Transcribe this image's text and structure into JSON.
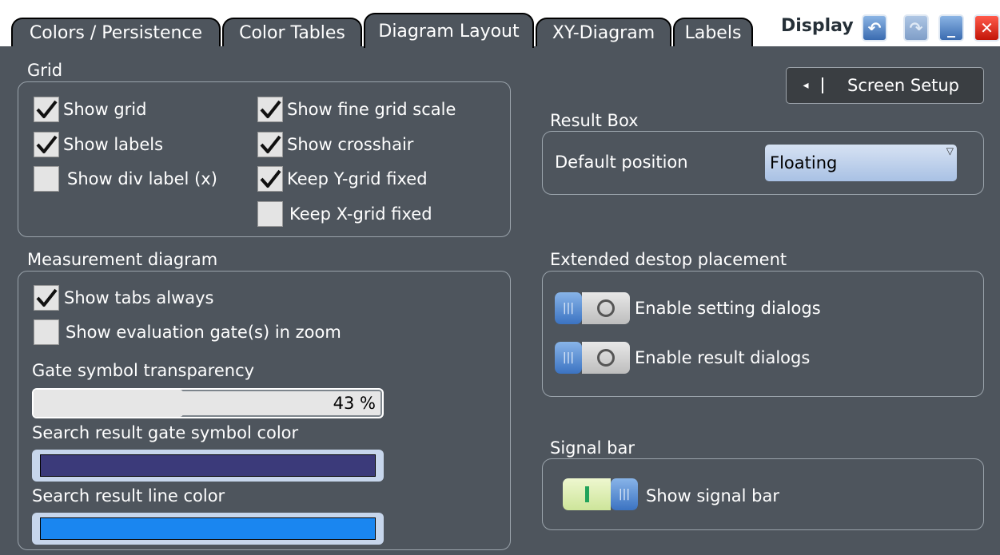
{
  "tabs": [
    {
      "label": "Colors / Persistence"
    },
    {
      "label": "Color Tables"
    },
    {
      "label": "Diagram Layout"
    },
    {
      "label": "XY-Diagram"
    },
    {
      "label": "Labels"
    }
  ],
  "window": {
    "title": "Display"
  },
  "grid": {
    "title": "Grid",
    "show_grid": {
      "label": "Show grid",
      "checked": true
    },
    "show_labels": {
      "label": "Show labels",
      "checked": true
    },
    "show_div_label": {
      "label": "Show div label (x)",
      "checked": false
    },
    "show_fine_grid_scale": {
      "label": "Show fine grid scale",
      "checked": true
    },
    "show_crosshair": {
      "label": "Show crosshair",
      "checked": true
    },
    "keep_y_grid_fixed": {
      "label": "Keep Y-grid fixed",
      "checked": true
    },
    "keep_x_grid_fixed": {
      "label": "Keep X-grid fixed",
      "checked": false
    }
  },
  "measurement": {
    "title": "Measurement diagram",
    "show_tabs_always": {
      "label": "Show tabs always",
      "checked": true
    },
    "show_eval_gates": {
      "label": "Show evaluation gate(s) in zoom",
      "checked": false
    },
    "gate_transparency_label": "Gate symbol transparency",
    "gate_transparency_value": "43 %",
    "gate_transparency_percent": 43,
    "search_gate_color_label": "Search result gate symbol color",
    "search_gate_color": "#3b3a7a",
    "search_line_color_label": "Search result line color",
    "search_line_color": "#1a86f0"
  },
  "screen_setup": {
    "label": "Screen Setup"
  },
  "result_box": {
    "title": "Result Box",
    "default_position_label": "Default position",
    "default_position_value": "Floating"
  },
  "extended": {
    "title": "Extended destop placement",
    "enable_setting_dialogs": {
      "label": "Enable setting dialogs",
      "on": false
    },
    "enable_result_dialogs": {
      "label": "Enable result dialogs",
      "on": false
    }
  },
  "signal_bar": {
    "title": "Signal bar",
    "show_signal_bar": {
      "label": "Show signal bar",
      "on": true
    }
  }
}
